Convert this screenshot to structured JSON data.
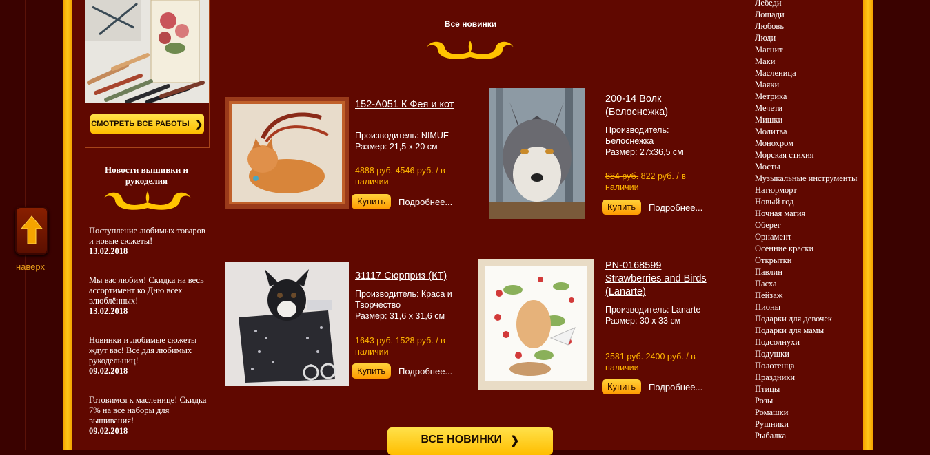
{
  "back_to_top": {
    "label": "наверх"
  },
  "promo": {
    "button_label": "СМОТРЕТЬ ВСЕ РАБОТЫ"
  },
  "news": {
    "title": "Новости вышивки и рукоделия",
    "items": [
      {
        "text": "Поступление любимых товаров и новые сюжеты!",
        "date": "13.02.2018"
      },
      {
        "text": "Мы вас любим! Скидка на весь ассортимент ко Дню всех влюблённых!",
        "date": "13.02.2018"
      },
      {
        "text": "Новинки и любимые сюжеты ждут вас! Всё для любимых рукодельниц!",
        "date": "09.02.2018"
      },
      {
        "text": "Готовимся к масленице! Скидка 7% на все наборы для вышивания!",
        "date": "09.02.2018"
      }
    ]
  },
  "new_items": {
    "title": "Все новинки",
    "buy_label": "Купить",
    "more_label": "Подробнее...",
    "all_button": "ВСЕ НОВИНКИ",
    "products": [
      {
        "name": "152-А051 К Фея и кот",
        "maker": "Производитель: NIMUE",
        "size": "Размер: 21,5 х 20 см",
        "old_price": "4888 руб.",
        "price": "4546 руб. / в наличии"
      },
      {
        "name": "200-14 Волк (Белоснежка)",
        "maker": "Производитель: Белоснежка",
        "size": "Размер: 27x36,5 см",
        "old_price": "884 руб.",
        "price": "822 руб. / в наличии"
      },
      {
        "name": "31117 Сюрприз (КТ)",
        "maker": "Производитель: Краса и Творчество",
        "size": "Размер: 31,6 х 31,6 см",
        "old_price": "1643 руб.",
        "price": "1528 руб. / в наличии"
      },
      {
        "name": "PN-0168599 Strawberries and Birds (Lanarte)",
        "maker": "Производитель: Lanarte",
        "size": "Размер: 30 х 33 см",
        "old_price": "2581 руб.",
        "price": "2400 руб. / в наличии"
      }
    ]
  },
  "categories": [
    "Лебеди",
    "Лошади",
    "Любовь",
    "Люди",
    "Магнит",
    "Маки",
    "Масленица",
    "Маяки",
    "Метрика",
    "Мечети",
    "Мишки",
    "Молитва",
    "Монохром",
    "Морская стихия",
    "Мосты",
    "Музыкальные инструменты",
    "Натюрморт",
    "Новый год",
    "Ночная магия",
    "Оберег",
    "Орнамент",
    "Осенние краски",
    "Открытки",
    "Павлин",
    "Пасха",
    "Пейзаж",
    "Пионы",
    "Подарки для девочек",
    "Подарки для мамы",
    "Подсолнухи",
    "Подушки",
    "Полотенца",
    "Праздники",
    "Птицы",
    "Розы",
    "Ромашки",
    "Рушники",
    "Рыбалка"
  ],
  "colors": {
    "background": "#600800",
    "gold": "#ffbe00",
    "price": "#ffb400",
    "dark": "#3b0300"
  }
}
